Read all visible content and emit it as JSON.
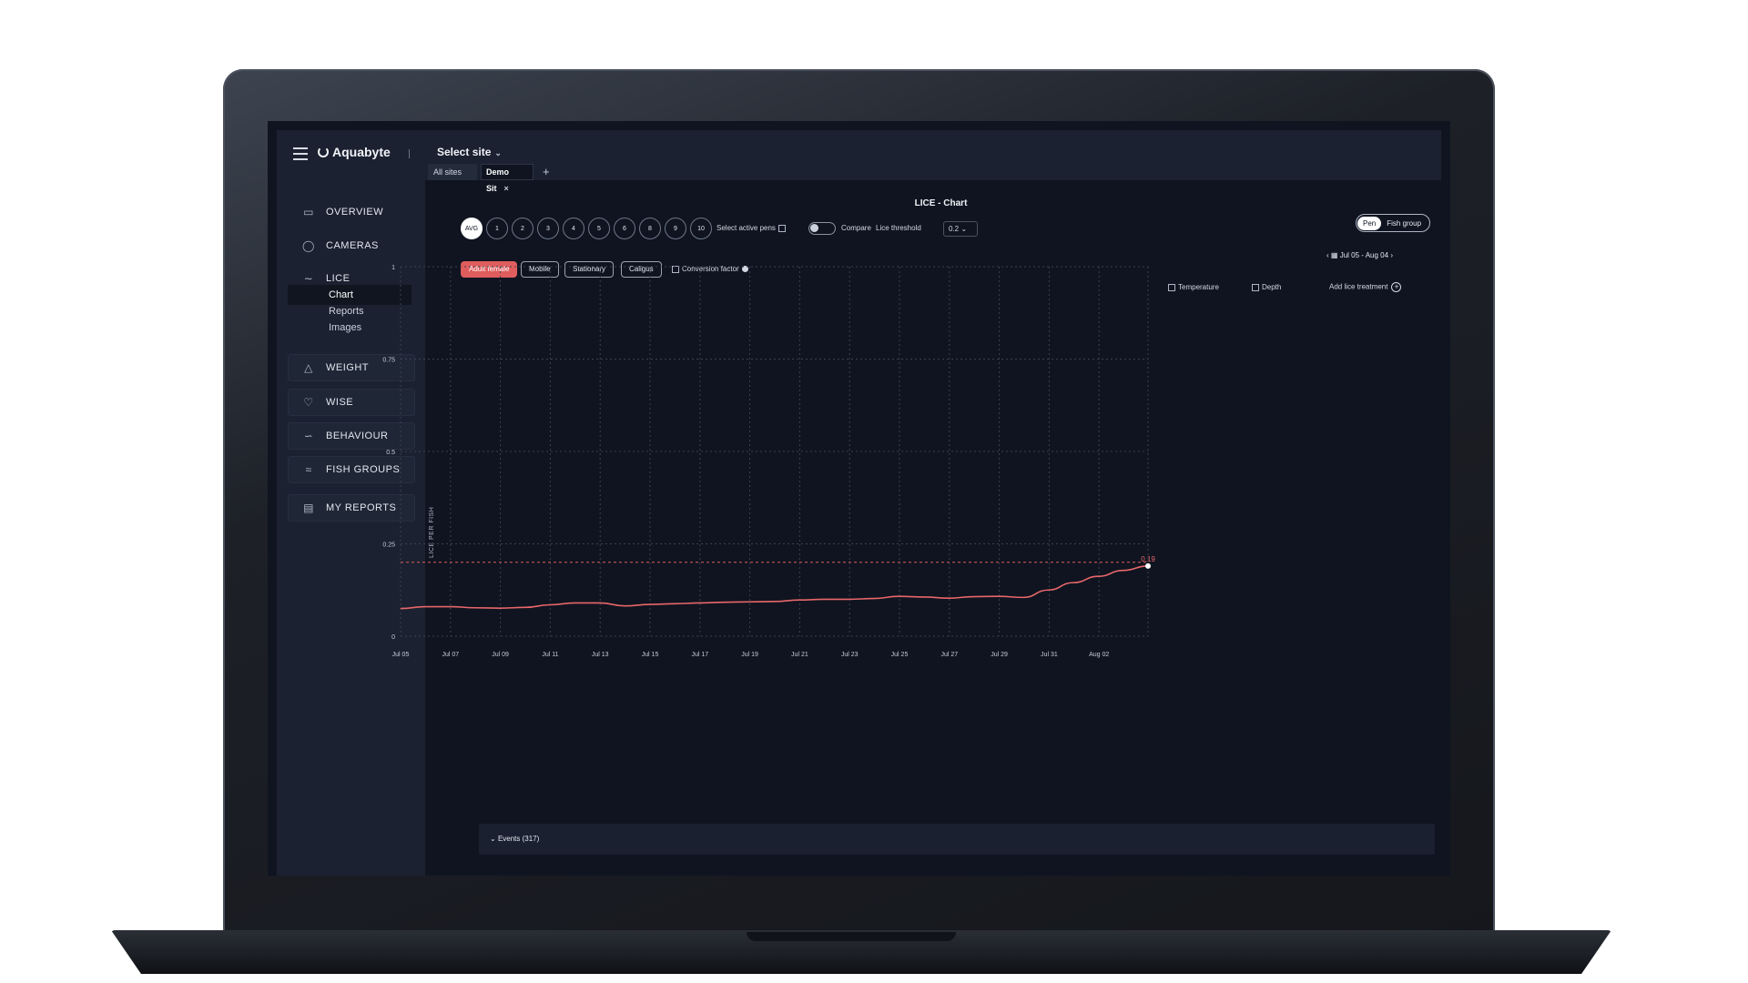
{
  "app": {
    "name": "Aquabyte",
    "site_select": "Select site"
  },
  "tabs": [
    {
      "label": "All sites"
    },
    {
      "label": "Demo Sit"
    }
  ],
  "sidebar": {
    "items": [
      {
        "label": "OVERVIEW",
        "icon": "monitor-icon"
      },
      {
        "label": "CAMERAS",
        "icon": "camera-icon"
      },
      {
        "label": "LICE",
        "icon": "fish-icon"
      },
      {
        "label": "WEIGHT",
        "icon": "weight-icon"
      },
      {
        "label": "WISE",
        "icon": "heart-icon"
      },
      {
        "label": "BEHAVIOUR",
        "icon": "behaviour-icon"
      },
      {
        "label": "FISH GROUPS",
        "icon": "fish-group-icon"
      },
      {
        "label": "MY REPORTS",
        "icon": "reports-icon"
      }
    ],
    "lice_sub": [
      "Chart",
      "Reports",
      "Images"
    ]
  },
  "page": {
    "title": "LICE",
    "title_sep": "-",
    "title_sub": "Chart",
    "pens": [
      "AVG",
      "1",
      "2",
      "3",
      "4",
      "5",
      "6",
      "8",
      "9",
      "10"
    ],
    "select_active_pens": "Select active pens",
    "compare": "Compare",
    "lice_threshold_label": "Lice threshold",
    "lice_threshold_value": "0.2",
    "view_toggle": {
      "on": "Pen",
      "off": "Fish group"
    },
    "date_range": "Jul 05 - Aug 04",
    "filters": [
      "Adult female",
      "Mobile",
      "Stationary",
      "Caligus"
    ],
    "conversion_factor": "Conversion factor",
    "temperature": "Temperature",
    "depth": "Depth",
    "add_treatment": "Add lice treatment",
    "events": "Events (317)"
  },
  "colors": {
    "series": "#e8676a",
    "threshold": "#e05d5d",
    "grid": "#3a4152"
  },
  "chart_data": {
    "type": "line",
    "ylabel": "LICE PER FISH",
    "ylim": [
      0,
      1
    ],
    "yticks": [
      "0",
      "0.25",
      "0.5",
      "0.75",
      "1"
    ],
    "xticks": [
      "Jul 05",
      "Jul 07",
      "Jul 09",
      "Jul 11",
      "Jul 13",
      "Jul 15",
      "Jul 17",
      "Jul 19",
      "Jul 21",
      "Jul 23",
      "Jul 25",
      "Jul 27",
      "Jul 29",
      "Jul 31",
      "Aug 02"
    ],
    "threshold": 0.2,
    "last_label": "0.19",
    "series": [
      {
        "values": [
          0.075,
          0.08,
          0.08,
          0.077,
          0.076,
          0.078,
          0.085,
          0.09,
          0.09,
          0.082,
          0.086,
          0.088,
          0.09,
          0.092,
          0.093,
          0.094,
          0.098,
          0.1,
          0.1,
          0.102,
          0.108,
          0.106,
          0.103,
          0.107,
          0.108,
          0.105,
          0.125,
          0.145,
          0.162,
          0.178,
          0.19
        ]
      }
    ]
  }
}
